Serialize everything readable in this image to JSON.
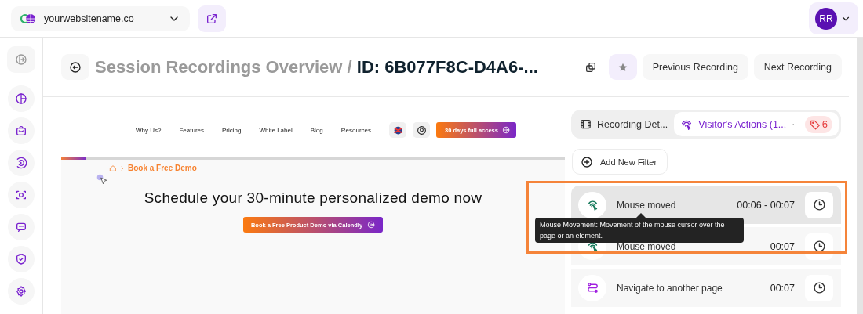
{
  "topbar": {
    "site_selector": {
      "value": "yourwebsitename.co"
    },
    "user": {
      "initials": "RR"
    }
  },
  "header": {
    "title_prefix": "Session Recordings Overview /",
    "title_id": "ID: 6B077F8C-D4A6-...",
    "starred": false,
    "buttons": [
      "Previous Recording",
      "Next Recording"
    ]
  },
  "preview": {
    "nav": [
      "Why Us?",
      "Features",
      "Pricing",
      "White Label",
      "Blog",
      "Resources"
    ],
    "cta": "30 days full access",
    "breadcrumb": "Book a Free Demo",
    "heading": "Schedule your 30-minute personalized demo now",
    "button": "Book a Free Product Demo via Calendly",
    "level": 0.05
  },
  "panel": {
    "tabs": [
      {
        "label": "Recording Det...",
        "kind": "film",
        "selected": false
      },
      {
        "label": "Visitor's Actions (1...",
        "kind": "actions",
        "selected": true
      }
    ],
    "separator": "·",
    "badge": "6",
    "add_filter": "Add New Filter",
    "actions": [
      {
        "kind": "mouse",
        "label": "Mouse moved",
        "time": "00:06 - 00:07",
        "hovered": true
      },
      {
        "kind": "mouse",
        "label": "Mouse moved",
        "time": "00:07",
        "hovered": false
      },
      {
        "kind": "navigate",
        "label": "Navigate to another page",
        "time": "00:07",
        "hovered": false
      }
    ],
    "tooltip": "Mouse Movement: Movement of the mouse cursor over the page or an element."
  }
}
